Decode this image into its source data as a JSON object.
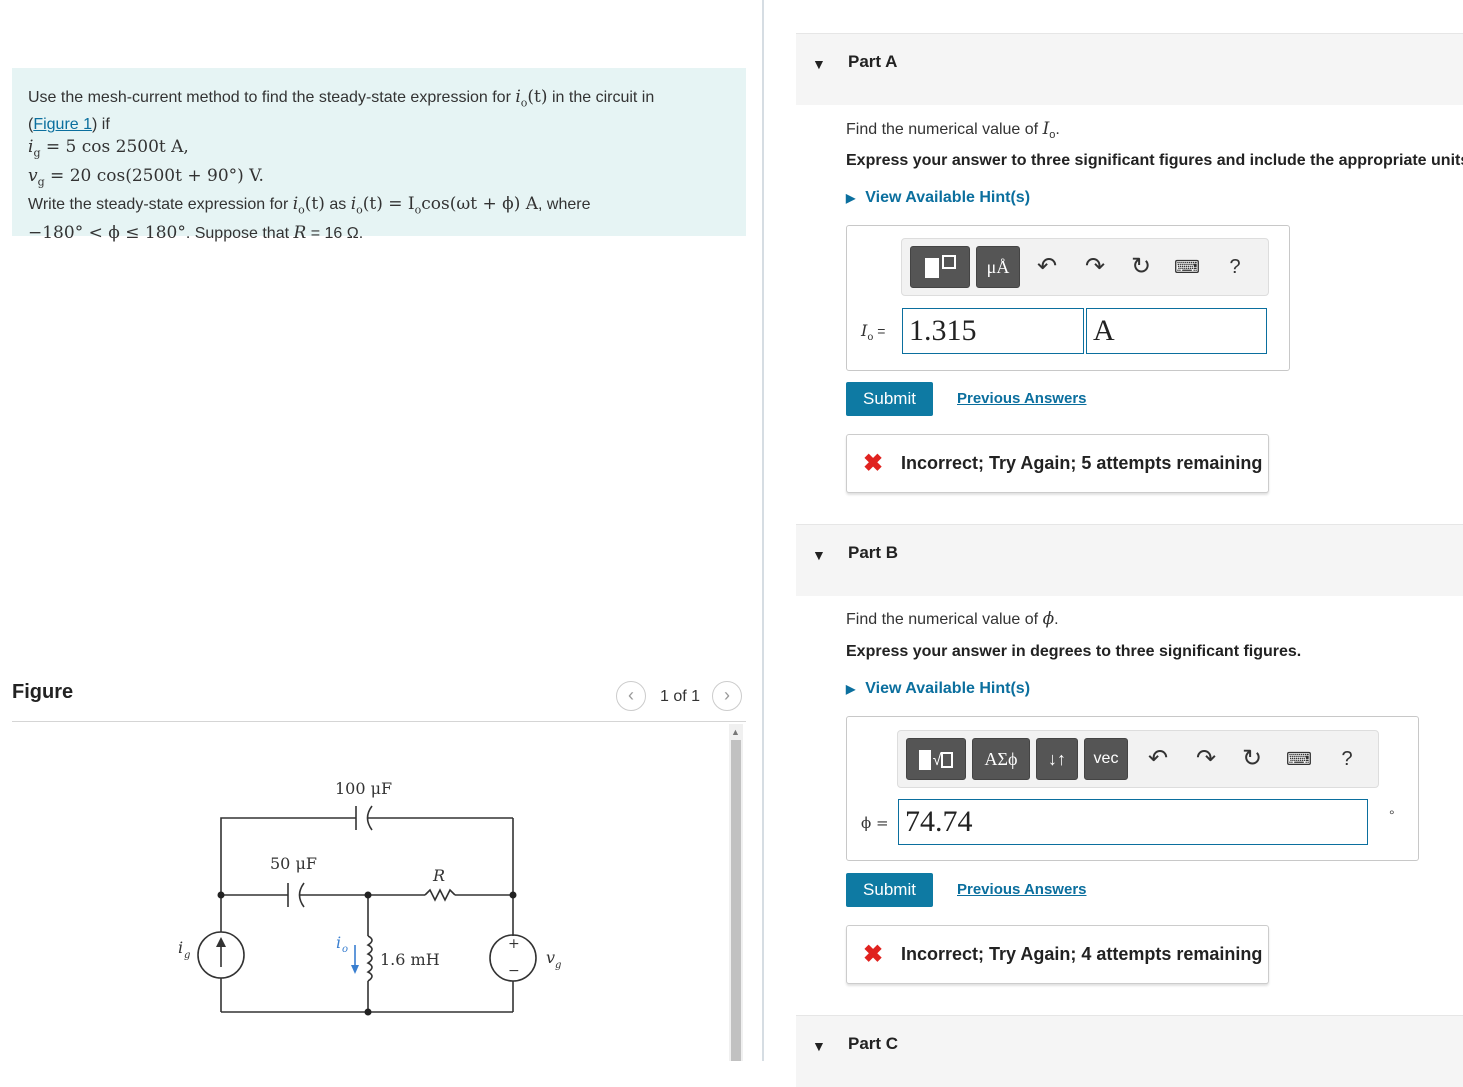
{
  "problem": {
    "line1_pre": "Use the mesh-current method to find the steady-state expression for",
    "line1_var": "i",
    "line1_sub": "o",
    "line1_arg": "(t)",
    "line1_post": "in the circuit in",
    "figure_link": "Figure 1",
    "line2_paren_open": "(",
    "line2_post": ") if",
    "ig_expr": "i",
    "ig_sub": "g",
    "ig_rhs": " = 5 cos 2500t A,",
    "vg_expr": "v",
    "vg_sub": "g",
    "vg_rhs": " = 20 cos(2500t + 90°) V.",
    "line5_pre": "Write the steady-state expression for",
    "line5_mid": "as",
    "line5_eq": "(t) = I",
    "line5_eq2": "cos(ωt + ϕ) A",
    "line5_post": ", where",
    "line6_ineq": "−180° < ϕ ≤ 180°",
    "line6_mid": ". Suppose that",
    "line6_R": "R",
    "line6_val": " = 16 Ω."
  },
  "figure": {
    "title": "Figure",
    "pager": "1 of 1",
    "prev_icon": "‹",
    "next_icon": "›",
    "circuit_labels": {
      "c1": "100 μF",
      "c2": "50 μF",
      "r": "R",
      "l": "1.6 mH",
      "ig": "i",
      "ig_sub": "g",
      "io": "i",
      "io_sub": "o",
      "vg": "v",
      "vg_sub": "g",
      "plus": "+",
      "minus": "−"
    }
  },
  "partA": {
    "title": "Part A",
    "prompt_pre": "Find the numerical value of",
    "prompt_var": "I",
    "prompt_sub": "o",
    "instruction": "Express your answer to three significant figures and include the appropriate units.",
    "hint": "View Available Hint(s)",
    "toolbar_btn2": "μÅ",
    "help": "?",
    "field_label": "I",
    "field_label_sub": "o",
    "field_label_eq": " =",
    "value": "1.315",
    "units": "A",
    "submit": "Submit",
    "previous": "Previous Answers",
    "feedback": "Incorrect; Try Again; 5 attempts remaining"
  },
  "partB": {
    "title": "Part B",
    "prompt_pre": "Find the numerical value of",
    "prompt_var": "ϕ",
    "instruction": "Express your answer in degrees to three significant figures.",
    "hint": "View Available Hint(s)",
    "toolbar_btn2": "ΑΣϕ",
    "toolbar_btn3": "↓↑",
    "toolbar_btn4": "vec",
    "help": "?",
    "field_label": "ϕ =",
    "value": "74.74",
    "degree": "°",
    "submit": "Submit",
    "previous": "Previous Answers",
    "feedback": "Incorrect; Try Again; 4 attempts remaining"
  },
  "partC": {
    "title": "Part C"
  },
  "colors": {
    "accent": "#0e7aa3",
    "link": "#0b6f9e",
    "error": "#e0221f",
    "problem_bg": "#e6f4f4"
  }
}
